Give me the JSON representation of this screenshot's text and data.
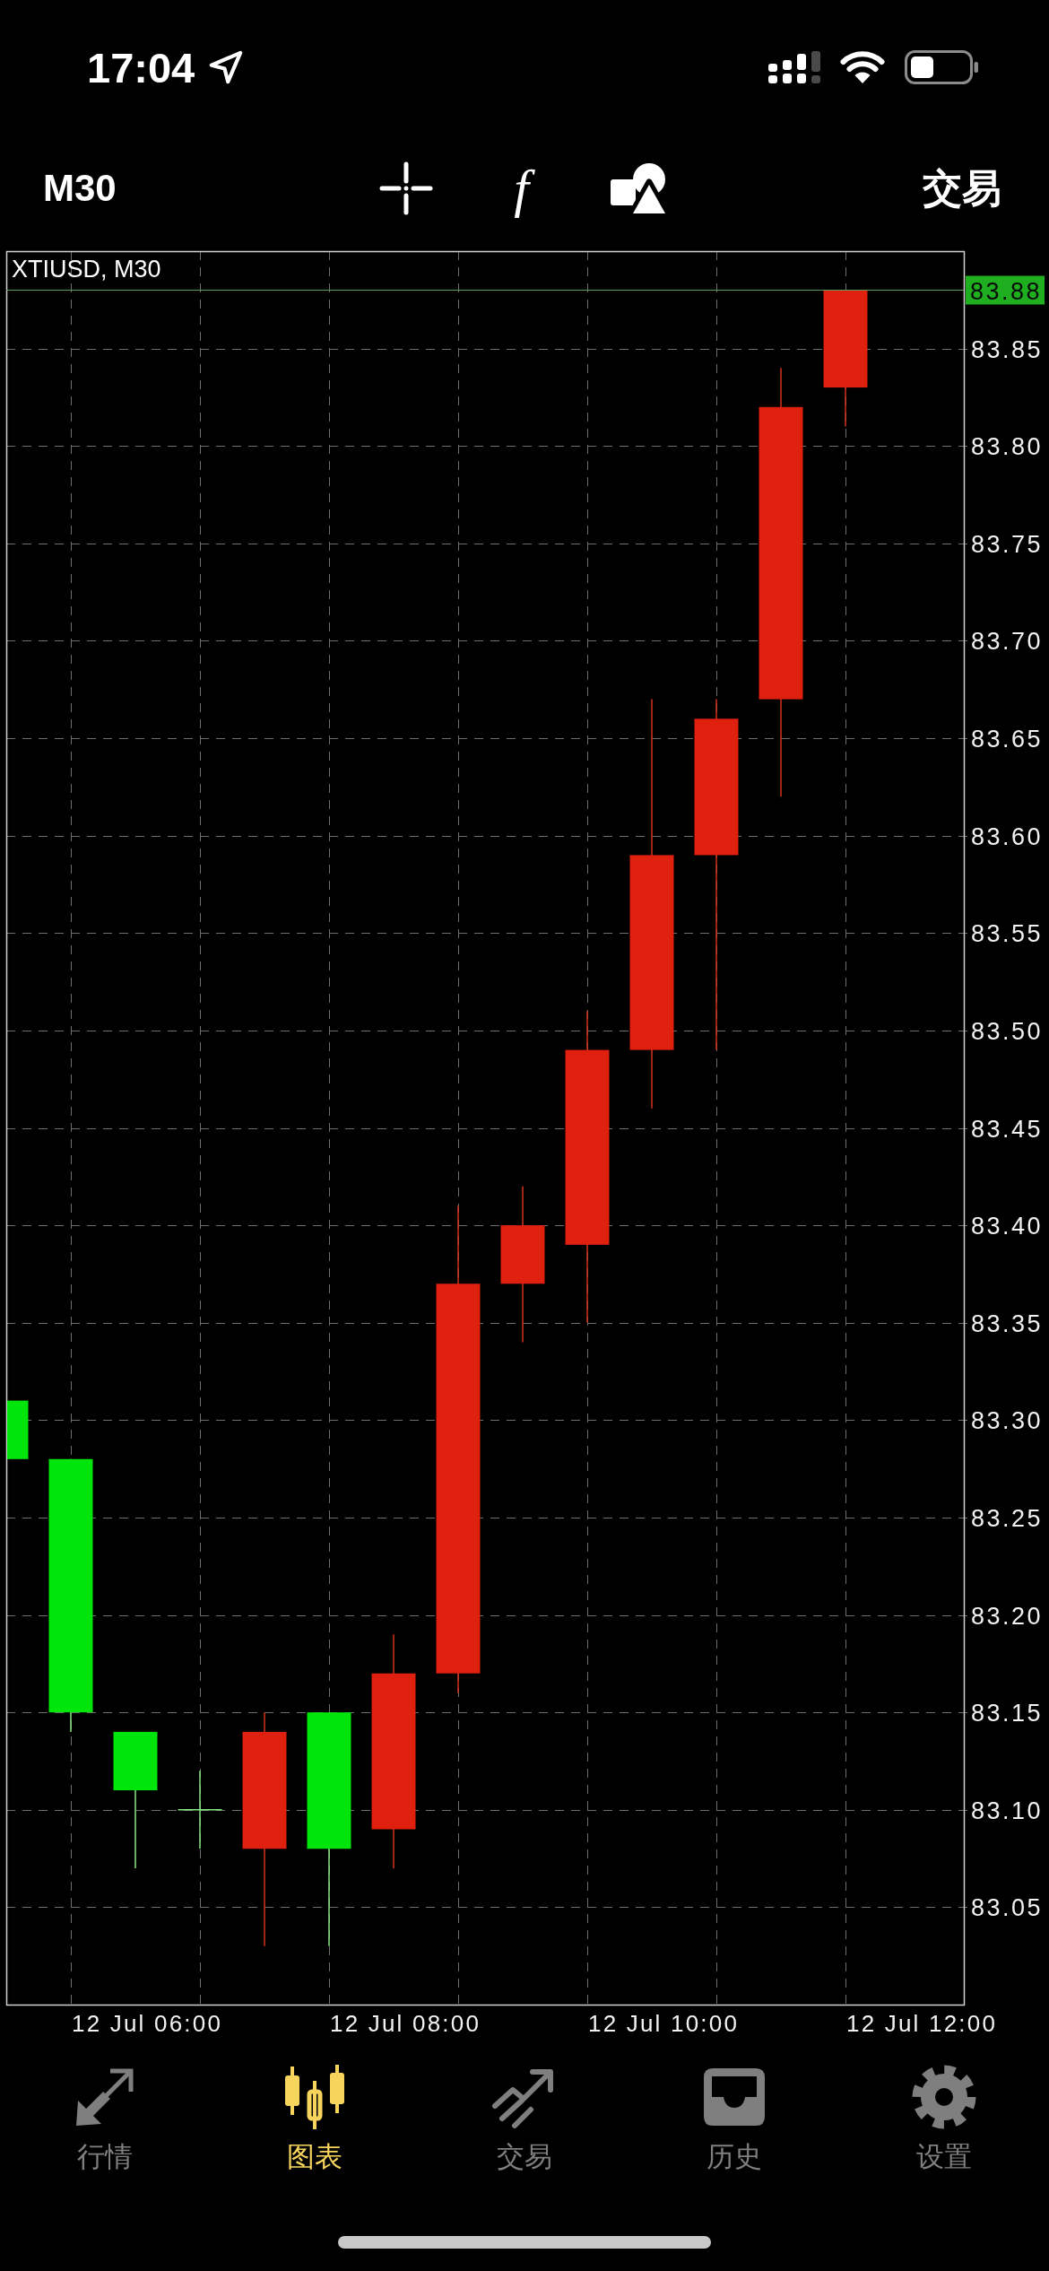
{
  "status_bar": {
    "time": "17:04"
  },
  "toolbar": {
    "timeframe": "M30",
    "tools": [
      {
        "kind": "crosshair"
      },
      {
        "kind": "function",
        "symbol": "f"
      },
      {
        "kind": "objects"
      }
    ],
    "action": "交易"
  },
  "chart": {
    "title": "XTIUSD, M30",
    "current_price": "83.88",
    "price_labels": [
      "83.85",
      "83.80",
      "83.75",
      "83.70",
      "83.65",
      "83.60",
      "83.55",
      "83.50",
      "83.45",
      "83.40",
      "83.35",
      "83.30",
      "83.25",
      "83.20",
      "83.15",
      "83.10",
      "83.05"
    ],
    "time_labels": [
      "12 Jul 06:00",
      "12 Jul 08:00",
      "12 Jul 10:00",
      "12 Jul 12:00"
    ]
  },
  "tab_bar": {
    "tabs": [
      {
        "label": "行情",
        "kind": "quotes",
        "selected": false
      },
      {
        "label": "图表",
        "kind": "chart",
        "selected": true
      },
      {
        "label": "交易",
        "kind": "trade",
        "selected": false
      },
      {
        "label": "历史",
        "kind": "history",
        "selected": false
      },
      {
        "label": "设置",
        "kind": "settings",
        "selected": false
      }
    ]
  }
}
